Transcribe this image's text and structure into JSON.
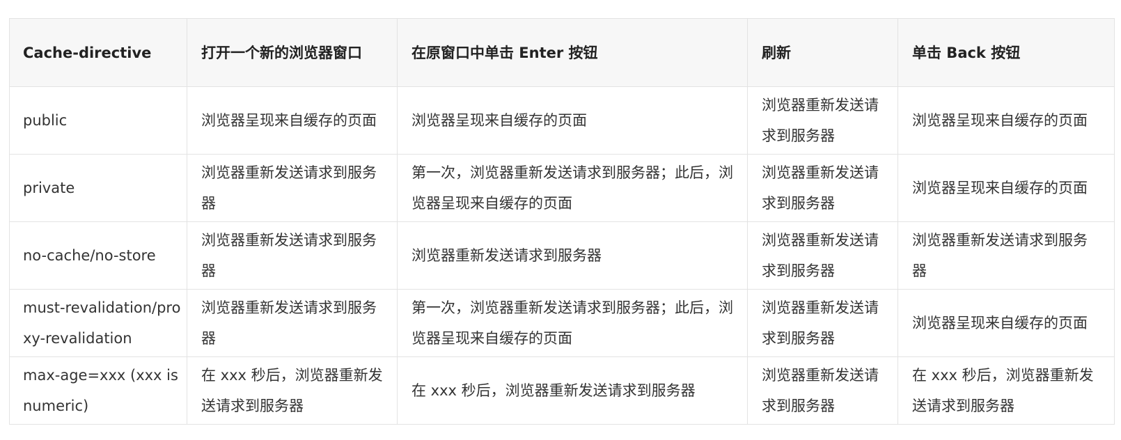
{
  "table": {
    "headers": [
      "Cache-directive",
      "打开一个新的浏览器窗口",
      "在原窗口中单击 Enter 按钮",
      "刷新",
      "单击 Back 按钮"
    ],
    "rows": [
      [
        "public",
        "浏览器呈现来自缓存的页面",
        "浏览器呈现来自缓存的页面",
        "浏览器重新发送请求到服务器",
        "浏览器呈现来自缓存的页面"
      ],
      [
        "private",
        "浏览器重新发送请求到服务器",
        "第一次，浏览器重新发送请求到服务器；此后，浏览器呈现来自缓存的页面",
        "浏览器重新发送请求到服务器",
        "浏览器呈现来自缓存的页面"
      ],
      [
        "no-cache/no-store",
        "浏览器重新发送请求到服务器",
        "浏览器重新发送请求到服务器",
        "浏览器重新发送请求到服务器",
        "浏览器重新发送请求到服务器"
      ],
      [
        "must-revalidation/proxy-revalidation",
        "浏览器重新发送请求到服务器",
        "第一次，浏览器重新发送请求到服务器；此后，浏览器呈现来自缓存的页面",
        "浏览器重新发送请求到服务器",
        "浏览器呈现来自缓存的页面"
      ],
      [
        "max-age=xxx (xxx is numeric)",
        "在 xxx 秒后，浏览器重新发送请求到服务器",
        "在 xxx 秒后，浏览器重新发送请求到服务器",
        "浏览器重新发送请求到服务器",
        "在 xxx 秒后，浏览器重新发送请求到服务器"
      ]
    ]
  }
}
